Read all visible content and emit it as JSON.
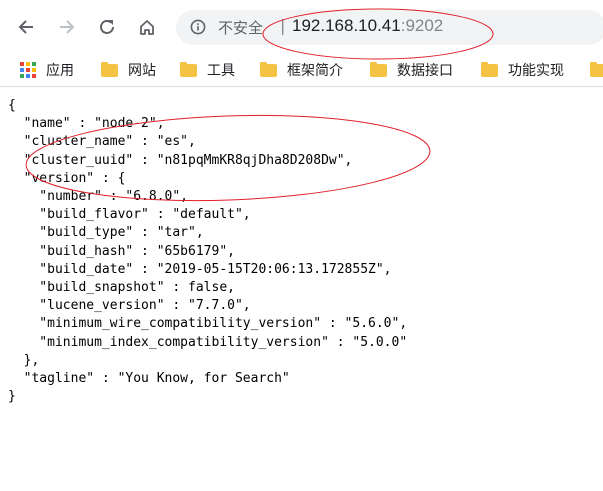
{
  "nav": {
    "back_icon": "arrow-left-icon",
    "forward_icon": "arrow-right-icon",
    "reload_icon": "reload-icon",
    "home_icon": "home-icon"
  },
  "address_bar": {
    "security_label": "不安全",
    "separator": "|",
    "host": "192.168.10.41",
    "port": ":9202"
  },
  "bookmarks": {
    "items": [
      {
        "label": "应用",
        "icon": "apps-grid-icon"
      },
      {
        "label": "网站",
        "icon": "folder-icon"
      },
      {
        "label": "工具",
        "icon": "folder-icon"
      },
      {
        "label": "框架简介",
        "icon": "folder-icon"
      },
      {
        "label": "数据接口",
        "icon": "folder-icon"
      },
      {
        "label": "功能实现",
        "icon": "folder-icon"
      }
    ]
  },
  "response": {
    "open_brace": "{",
    "close_brace": "}",
    "lines": [
      "  \"name\" : \"node-2\",",
      "  \"cluster_name\" : \"es\",",
      "  \"cluster_uuid\" : \"n81pqMmKR8qjDha8D208Dw\",",
      "  \"version\" : {",
      "    \"number\" : \"6.8.0\",",
      "    \"build_flavor\" : \"default\",",
      "    \"build_type\" : \"tar\",",
      "    \"build_hash\" : \"65b6179\",",
      "    \"build_date\" : \"2019-05-15T20:06:13.172855Z\",",
      "    \"build_snapshot\" : false,",
      "    \"lucene_version\" : \"7.7.0\",",
      "    \"minimum_wire_compatibility_version\" : \"5.6.0\",",
      "    \"minimum_index_compatibility_version\" : \"5.0.0\"",
      "  },",
      "  \"tagline\" : \"You Know, for Search\""
    ]
  },
  "colors": {
    "annotation": "#e0202a",
    "folder": "#f5c343"
  }
}
